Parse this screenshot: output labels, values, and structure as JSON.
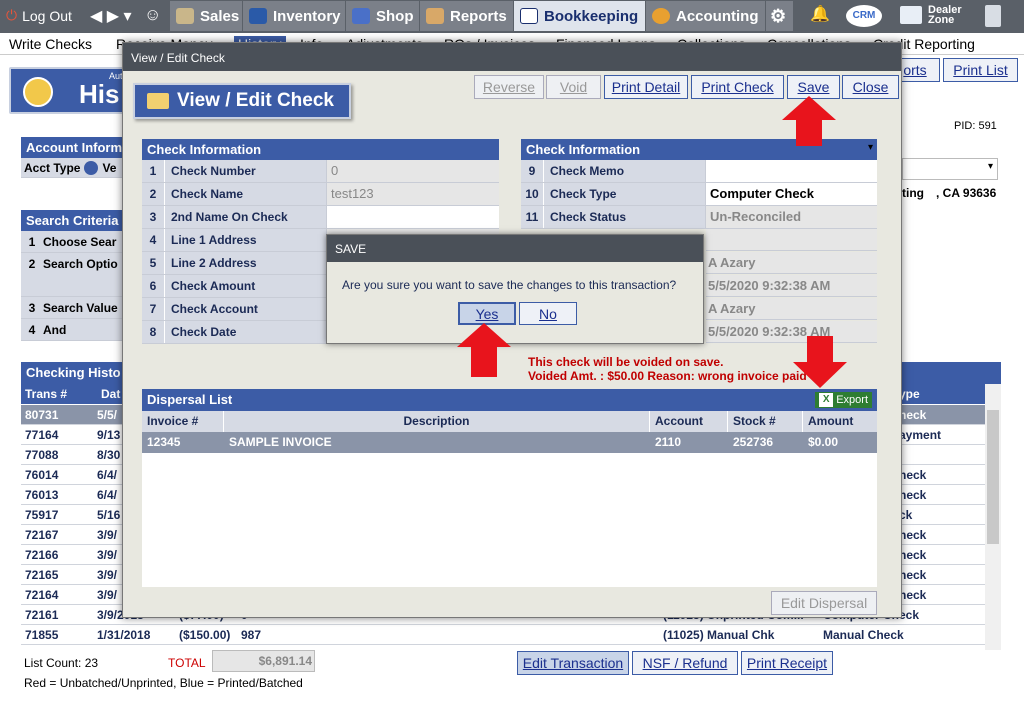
{
  "topnav": {
    "logout": "Log Out",
    "tabs": [
      "Sales",
      "Inventory",
      "Shop",
      "Reports",
      "Bookkeeping",
      "Accounting"
    ],
    "active_tab": "Bookkeeping",
    "crm": "CRM",
    "dealer_zone_1": "Dealer",
    "dealer_zone_2": "Zone"
  },
  "subnav": [
    "Write Checks",
    "Receive Money",
    "History",
    "Info",
    "Adjustments",
    "ROs / Invoices",
    "Financed Loans",
    "Collections",
    "Cancellations",
    "Credit Reporting"
  ],
  "background": {
    "auto": "Aut",
    "history_title": "His",
    "reports_btn": "orts",
    "print_list_btn": "Print List",
    "pid": "PID: 591",
    "account_info_hdr": "Account Inform",
    "acct_type_label": "Acct Type",
    "acct_type_val": "Ve",
    "address_frag1": "ting",
    "address_frag2": ", CA 93636",
    "search_hdr": "Search Criteria",
    "search_rows": [
      {
        "num": "1",
        "label": "Choose Sear"
      },
      {
        "num": "2",
        "label": "Search Optio"
      },
      {
        "num": "3",
        "label": "Search Value"
      },
      {
        "num": "4",
        "label": "And"
      }
    ],
    "history_hdr": "Checking Histo",
    "cols": [
      "Trans #",
      "Dat"
    ],
    "type_col": "ype",
    "rows": [
      {
        "trans": "80731",
        "date": "5/5/",
        "type": "heck"
      },
      {
        "trans": "77164",
        "date": "9/13",
        "type": "ayment"
      },
      {
        "trans": "77088",
        "date": "8/30",
        "type": ""
      },
      {
        "trans": "76014",
        "date": "6/4/",
        "type": "heck"
      },
      {
        "trans": "76013",
        "date": "6/4/",
        "type": "heck"
      },
      {
        "trans": "75917",
        "date": "5/16",
        "type": "ck"
      },
      {
        "trans": "72167",
        "date": "3/9/",
        "type": "heck"
      },
      {
        "trans": "72166",
        "date": "3/9/",
        "type": "heck"
      },
      {
        "trans": "72165",
        "date": "3/9/",
        "type": "heck"
      },
      {
        "trans": "72164",
        "date": "3/9/",
        "type": "heck"
      },
      {
        "trans": "72161",
        "date": "3/9/2018",
        "amount": "($77.00)",
        "num": "0",
        "account": "(11025) Unprinted Com...",
        "type": "Computer Check"
      },
      {
        "trans": "71855",
        "date": "1/31/2018",
        "amount": "($150.00)",
        "num": "987",
        "account": "(11025) Manual Chk",
        "type": "Manual Check"
      }
    ],
    "list_count": "List Count: 23",
    "total_label": "TOTAL",
    "total_val": "$6,891.14",
    "legend": "Red = Unbatched/Unprinted, Blue = Printed/Batched",
    "edit_txn": "Edit Transaction",
    "nsf_refund": "NSF / Refund",
    "print_receipt": "Print Receipt"
  },
  "modal": {
    "title": "View / Edit Check",
    "header_label": "View / Edit Check",
    "buttons": {
      "reverse": "Reverse",
      "void": "Void",
      "print_detail": "Print Detail",
      "print_check": "Print Check",
      "save": "Save",
      "close": "Close"
    },
    "left_hdr": "Check Information",
    "left_rows": [
      {
        "num": "1",
        "label": "Check Number",
        "value": "0"
      },
      {
        "num": "2",
        "label": "Check Name",
        "value": "test123"
      },
      {
        "num": "3",
        "label": "2nd Name On Check",
        "value": ""
      },
      {
        "num": "4",
        "label": "Line 1 Address",
        "value": ""
      },
      {
        "num": "5",
        "label": "Line 2 Address",
        "value": ""
      },
      {
        "num": "6",
        "label": "Check Amount",
        "value": ""
      },
      {
        "num": "7",
        "label": "Check Account",
        "value": ""
      },
      {
        "num": "8",
        "label": "Check Date",
        "value": ""
      }
    ],
    "right_hdr": "Check Information",
    "right_rows": [
      {
        "num": "9",
        "label": "Check Memo",
        "value": ""
      },
      {
        "num": "10",
        "label": "Check Type",
        "value": "Computer Check"
      },
      {
        "num": "11",
        "label": "Check Status",
        "value": "Un-Reconciled"
      }
    ],
    "right_extra": [
      "A Azary",
      "5/5/2020 9:32:38 AM",
      "A Azary",
      "5/5/2020 9:32:38 AM"
    ],
    "void_notice_1": "This check will be voided on save.",
    "void_notice_2": "Voided Amt. : $50.00 Reason: wrong invoice paid",
    "dispersal_hdr": "Dispersal List",
    "export": "Export",
    "disp_cols": [
      "Invoice #",
      "Description",
      "Account",
      "Stock #",
      "Amount"
    ],
    "disp_row": {
      "invoice": "12345",
      "description": "SAMPLE INVOICE",
      "account": "2110",
      "stock": "252736",
      "amount": "$0.00"
    },
    "edit_dispersal": "Edit Dispersal"
  },
  "save_dialog": {
    "title": "SAVE",
    "message": "Are you sure you want to save the changes to this transaction?",
    "yes": "Yes",
    "no": "No"
  },
  "colors": {
    "accent": "#3c5ca6",
    "arrow": "#e8141c",
    "notice": "#c00000"
  }
}
